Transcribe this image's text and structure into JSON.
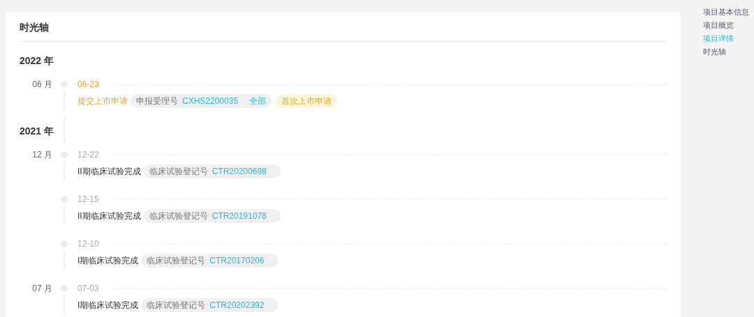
{
  "card": {
    "title": "时光轴",
    "years": [
      {
        "year": "2022 年",
        "months": [
          {
            "month": "06 月",
            "events": [
              {
                "date": "06-23",
                "title": "提交上市申请",
                "highlighted": true,
                "tag": {
                  "label": "申报受理号",
                  "value": "CXHS2200035",
                  "scope": "全部"
                },
                "badge": "首次上市申请"
              }
            ]
          }
        ]
      },
      {
        "year": "2021 年",
        "months": [
          {
            "month": "12 月",
            "events": [
              {
                "date": "12-22",
                "title": "II期临床试验完成",
                "highlighted": false,
                "tag": {
                  "label": "临床试验登记号",
                  "value": "CTR20200698"
                }
              },
              {
                "date": "12-15",
                "title": "II期临床试验完成",
                "highlighted": false,
                "tag": {
                  "label": "临床试验登记号",
                  "value": "CTR20191078"
                }
              },
              {
                "date": "12-10",
                "title": "I期临床试验完成",
                "highlighted": false,
                "tag": {
                  "label": "临床试验登记号",
                  "value": "CTR20170206"
                }
              }
            ]
          },
          {
            "month": "07 月",
            "events": [
              {
                "date": "07-03",
                "title": "I期临床试验完成",
                "highlighted": false,
                "tag": {
                  "label": "临床试验登记号",
                  "value": "CTR20202392"
                }
              }
            ]
          }
        ]
      }
    ]
  },
  "side_nav": {
    "items": [
      {
        "label": "项目基本信息",
        "selected": false
      },
      {
        "label": "项目概览",
        "selected": false
      },
      {
        "label": "项目详情",
        "selected": true
      },
      {
        "label": "时光轴",
        "selected": false
      }
    ]
  }
}
